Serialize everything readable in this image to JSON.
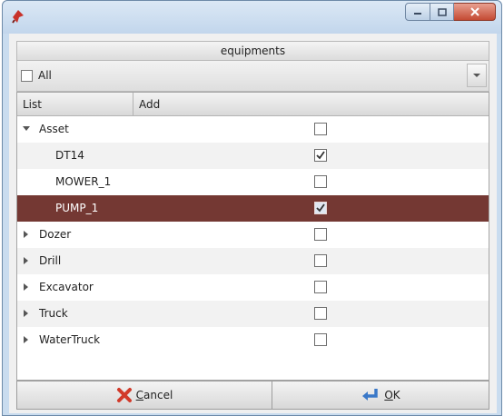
{
  "window": {
    "app_icon": "red-diamond-icon",
    "controls": [
      "minimize-icon",
      "maximize-icon",
      "close-icon"
    ]
  },
  "panel": {
    "title": "equipments"
  },
  "filter": {
    "all_label": "All",
    "all_checked": false,
    "dropdown_icon": "chevron-down-icon"
  },
  "columns": {
    "list": "List",
    "add": "Add"
  },
  "rows": [
    {
      "label": "Asset",
      "level": 0,
      "expander": "expanded",
      "checked": false,
      "selected": false,
      "alt": false
    },
    {
      "label": "DT14",
      "level": 1,
      "expander": "none",
      "checked": true,
      "selected": false,
      "alt": true
    },
    {
      "label": "MOWER_1",
      "level": 1,
      "expander": "none",
      "checked": false,
      "selected": false,
      "alt": false
    },
    {
      "label": "PUMP_1",
      "level": 1,
      "expander": "none",
      "checked": true,
      "selected": true,
      "alt": false
    },
    {
      "label": "Dozer",
      "level": 0,
      "expander": "collapsed",
      "checked": false,
      "selected": false,
      "alt": false
    },
    {
      "label": "Drill",
      "level": 0,
      "expander": "collapsed",
      "checked": false,
      "selected": false,
      "alt": true
    },
    {
      "label": "Excavator",
      "level": 0,
      "expander": "collapsed",
      "checked": false,
      "selected": false,
      "alt": false
    },
    {
      "label": "Truck",
      "level": 0,
      "expander": "collapsed",
      "checked": false,
      "selected": false,
      "alt": true
    },
    {
      "label": "WaterTruck",
      "level": 0,
      "expander": "collapsed",
      "checked": false,
      "selected": false,
      "alt": false
    }
  ],
  "buttons": {
    "cancel": {
      "mnemonic": "C",
      "rest": "ancel",
      "icon": "red-x-icon"
    },
    "ok": {
      "mnemonic": "O",
      "rest": "K",
      "icon": "blue-return-arrow-icon"
    }
  },
  "colors": {
    "selected_row": "#743833",
    "cancel_icon": "#d23a2a",
    "ok_icon": "#3a78c8"
  }
}
